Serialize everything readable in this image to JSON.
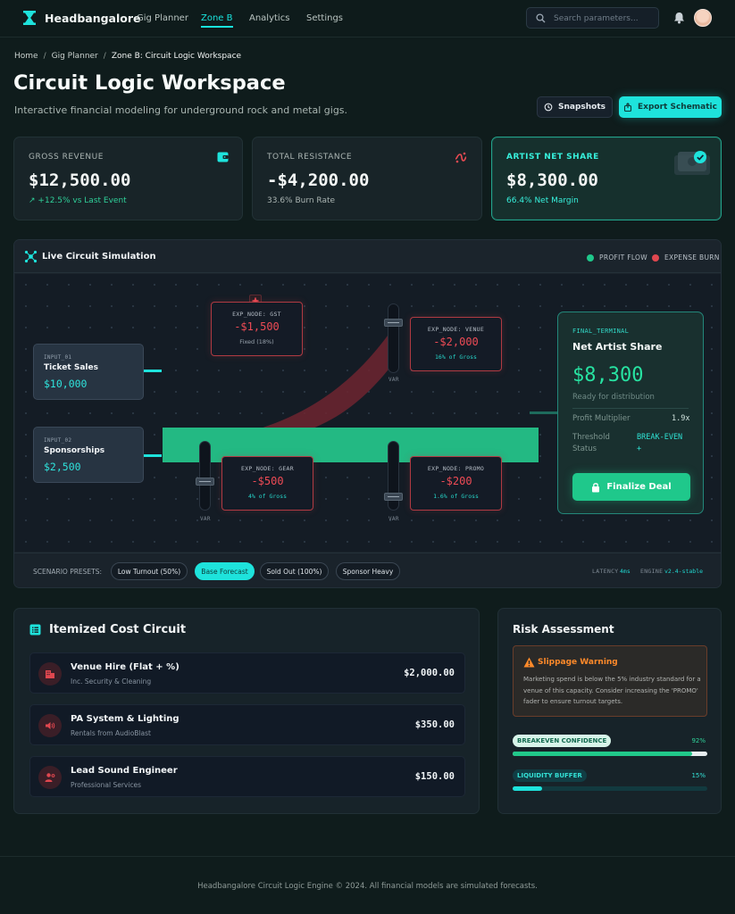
{
  "brand": {
    "name": "Headbangalore"
  },
  "nav": {
    "links": [
      "Gig Planner",
      "Zone B",
      "Analytics",
      "Settings"
    ],
    "active": "Zone B",
    "search_placeholder": "Search parameters..."
  },
  "breadcrumb": [
    "Home",
    "Gig Planner",
    "Zone B: Circuit Logic Workspace"
  ],
  "header": {
    "title": "Circuit Logic Workspace",
    "subtitle": "Interactive financial modeling for underground rock and metal gigs.",
    "snapshots_label": "Snapshots",
    "export_label": "Export Schematic"
  },
  "stats": [
    {
      "label": "GROSS REVENUE",
      "value": "$12,500.00",
      "meta": "+12.5% vs Last Event"
    },
    {
      "label": "TOTAL RESISTANCE",
      "value": "-$4,200.00",
      "meta": "33.6% Burn Rate"
    },
    {
      "label": "ARTIST NET SHARE",
      "value": "$8,300.00",
      "meta": "66.4% Net Margin"
    }
  ],
  "circuit": {
    "title": "Live Circuit Simulation",
    "legend": [
      "PROFIT FLOW",
      "EXPENSE BURN"
    ],
    "inputs": [
      {
        "id": "INPUT_01",
        "name": "Ticket Sales",
        "value": "$10,000"
      },
      {
        "id": "INPUT_02",
        "name": "Sponsorships",
        "value": "$2,500"
      }
    ],
    "expenses": [
      {
        "id": "EXP_NODE: GST",
        "value": "-$1,500",
        "note": "Fixed (18%)"
      },
      {
        "id": "EXP_NODE: VENUE",
        "value": "-$2,000",
        "note": "16% of Gross"
      },
      {
        "id": "EXP_NODE: GEAR",
        "value": "-$500",
        "note": "4% of Gross"
      },
      {
        "id": "EXP_NODE: PROMO",
        "value": "-$200",
        "note": "1.6% of Gross"
      }
    ],
    "fader_label": "VAR",
    "terminal": {
      "id": "FINAL_TERMINAL",
      "title": "Net Artist Share",
      "value": "$8,300",
      "note": "Ready for distribution",
      "multiplier_label": "Profit Multiplier",
      "multiplier_value": "1.9x",
      "threshold_label_1": "Threshold",
      "threshold_label_2": "Status",
      "threshold_value_1": "BREAK-EVEN",
      "threshold_value_2": "+",
      "button": "Finalize Deal"
    },
    "presets_label": "SCENARIO PRESETS:",
    "presets": [
      "Low Turnout (50%)",
      "Base Forecast",
      "Sold Out (100%)",
      "Sponsor Heavy"
    ],
    "active_preset": "Base Forecast",
    "latency_label": "LATENCY",
    "latency_value": "4ms",
    "engine_label": "ENGINE",
    "engine_value": "v2.4-stable"
  },
  "costs": {
    "title": "Itemized Cost Circuit",
    "items": [
      {
        "name": "Venue Hire (Flat + %)",
        "sub": "Inc. Security & Cleaning",
        "amount": "$2,000.00",
        "icon": "building-icon"
      },
      {
        "name": "PA System & Lighting",
        "sub": "Rentals from AudioBlast",
        "amount": "$350.00",
        "icon": "speaker-icon"
      },
      {
        "name": "Lead Sound Engineer",
        "sub": "Professional Services",
        "amount": "$150.00",
        "icon": "engineer-icon"
      }
    ]
  },
  "risk": {
    "title": "Risk Assessment",
    "warning_title": "Slippage Warning",
    "warning_text": "Marketing spend is below the 5% industry standard for a venue of this capacity. Consider increasing the 'PROMO' fader to ensure turnout targets.",
    "meters": [
      {
        "label": "BREAKEVEN CONFIDENCE",
        "percent_label": "92%",
        "value": 0.92
      },
      {
        "label": "LIQUIDITY BUFFER",
        "percent_label": "15%",
        "value": 0.15
      }
    ]
  },
  "footer": "Headbangalore Circuit Logic Engine © 2024. All financial models are simulated forecasts.",
  "colors": {
    "accent": "#1ee3dc",
    "profit": "#1fc88b",
    "expense": "#e0474f",
    "warning": "#ff8a2a"
  }
}
